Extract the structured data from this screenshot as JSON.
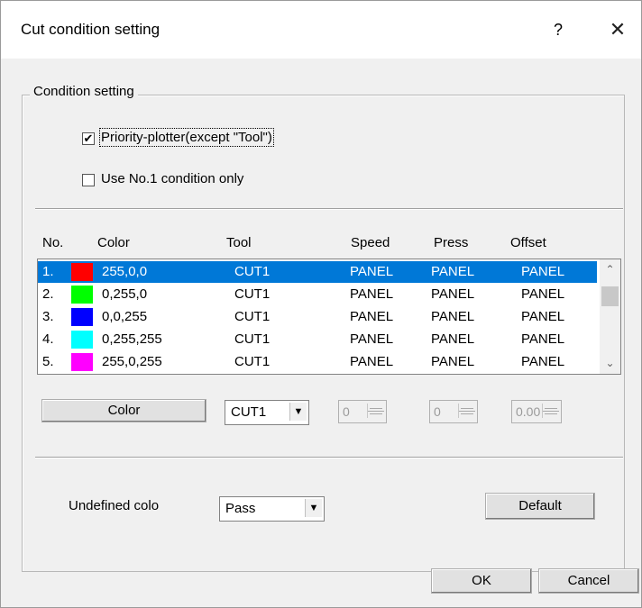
{
  "window": {
    "title": "Cut condition setting",
    "help_glyph": "?",
    "close_glyph": "✕"
  },
  "group": {
    "label": "Condition setting"
  },
  "options": {
    "priority_plotter": {
      "label": "Priority-plotter(except \"Tool\")",
      "checked": true,
      "mark": "✔"
    },
    "use_no1": {
      "label": "Use No.1 condition only",
      "checked": false,
      "mark": ""
    }
  },
  "table": {
    "headers": {
      "no": "No.",
      "color": "Color",
      "tool": "Tool",
      "speed": "Speed",
      "press": "Press",
      "offset": "Offset"
    },
    "rows": [
      {
        "no": "1.",
        "swatch": "#ff0000",
        "color": "255,0,0",
        "tool": "CUT1",
        "speed": "PANEL",
        "press": "PANEL",
        "offset": "PANEL",
        "selected": true
      },
      {
        "no": "2.",
        "swatch": "#00ff00",
        "color": "0,255,0",
        "tool": "CUT1",
        "speed": "PANEL",
        "press": "PANEL",
        "offset": "PANEL",
        "selected": false
      },
      {
        "no": "3.",
        "swatch": "#0000ff",
        "color": "0,0,255",
        "tool": "CUT1",
        "speed": "PANEL",
        "press": "PANEL",
        "offset": "PANEL",
        "selected": false
      },
      {
        "no": "4.",
        "swatch": "#00ffff",
        "color": "0,255,255",
        "tool": "CUT1",
        "speed": "PANEL",
        "press": "PANEL",
        "offset": "PANEL",
        "selected": false
      },
      {
        "no": "5.",
        "swatch": "#ff00ff",
        "color": "255,0,255",
        "tool": "CUT1",
        "speed": "PANEL",
        "press": "PANEL",
        "offset": "PANEL",
        "selected": false
      }
    ],
    "scroll_up": "⌃",
    "scroll_down": "⌄"
  },
  "controls": {
    "color_button": "Color",
    "tool_select": "CUT1",
    "speed_value": "0",
    "press_value": "0",
    "offset_value": "0.00",
    "dropdown_glyph": "▼"
  },
  "undefined": {
    "label": "Undefined colo",
    "select": "Pass",
    "default_button": "Default"
  },
  "footer": {
    "ok": "OK",
    "cancel": "Cancel"
  },
  "colors": {
    "selection": "#0078d7",
    "dialog_bg": "#f0f0f0"
  }
}
